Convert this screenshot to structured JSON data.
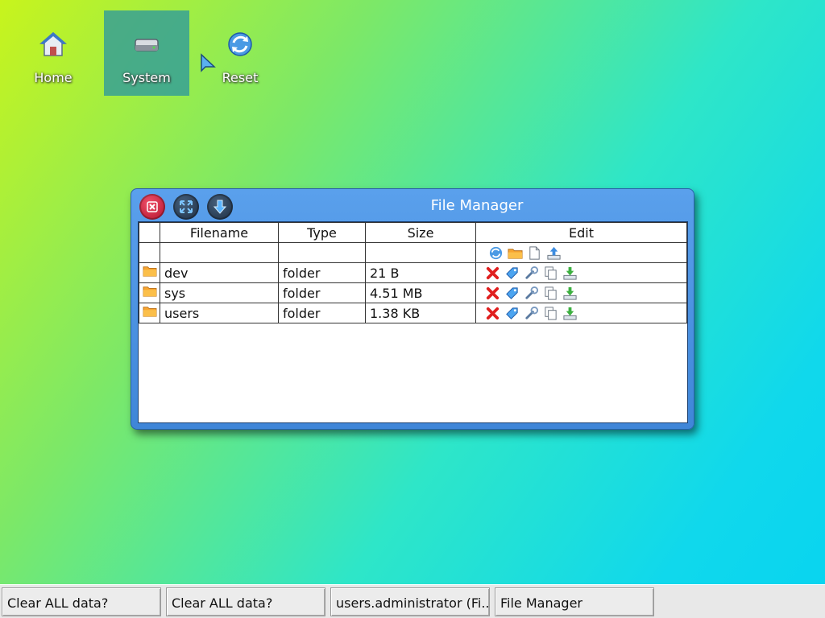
{
  "desktop": {
    "icons": [
      {
        "label": "Home",
        "icon": "home-icon"
      },
      {
        "label": "System",
        "icon": "drive-icon",
        "selected": true
      },
      {
        "label": "Reset",
        "icon": "reset-icon"
      }
    ]
  },
  "window": {
    "title": "File Manager",
    "buttons": [
      "close-icon",
      "maximize-icon",
      "minimize-icon"
    ],
    "table": {
      "headers": [
        "",
        "Filename",
        "Type",
        "Size",
        "Edit"
      ],
      "toolbar_icons": [
        "refresh-icon",
        "new-folder-icon",
        "new-file-icon",
        "upload-icon"
      ],
      "rows": [
        {
          "name": "dev",
          "type": "folder",
          "size": "21 B"
        },
        {
          "name": "sys",
          "type": "folder",
          "size": "4.51 MB"
        },
        {
          "name": "users",
          "type": "folder",
          "size": "1.38 KB"
        }
      ],
      "row_actions": [
        "delete-icon",
        "rename-icon",
        "properties-icon",
        "copy-icon",
        "download-icon"
      ]
    }
  },
  "taskbar": {
    "items": [
      {
        "label": "Clear ALL data?"
      },
      {
        "label": "Clear ALL data?"
      },
      {
        "label": "users.administrator (Fi..."
      },
      {
        "label": "File Manager"
      }
    ]
  }
}
